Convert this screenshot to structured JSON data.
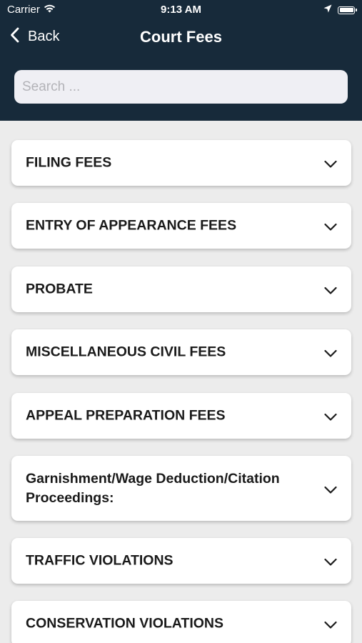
{
  "status_bar": {
    "carrier": "Carrier",
    "time": "9:13 AM",
    "icons": [
      "wifi-icon",
      "location-arrow-icon",
      "battery-icon"
    ]
  },
  "nav": {
    "back_label": "Back",
    "title": "Court Fees"
  },
  "search": {
    "placeholder": "Search ...",
    "value": ""
  },
  "colors": {
    "header_background": "#172a3a",
    "page_background": "#ececec",
    "card_background": "#ffffff",
    "text": "#1a1a1a"
  },
  "fee_categories": [
    {
      "label": "FILING FEES",
      "expanded": false
    },
    {
      "label": "ENTRY OF APPEARANCE FEES",
      "expanded": false
    },
    {
      "label": "PROBATE",
      "expanded": false
    },
    {
      "label": "MISCELLANEOUS CIVIL FEES",
      "expanded": false
    },
    {
      "label": "APPEAL PREPARATION FEES",
      "expanded": false
    },
    {
      "label": "Garnishment/Wage Deduction/Citation Proceedings:",
      "expanded": false
    },
    {
      "label": "TRAFFIC VIOLATIONS",
      "expanded": false
    },
    {
      "label": "CONSERVATION VIOLATIONS",
      "expanded": false
    }
  ]
}
